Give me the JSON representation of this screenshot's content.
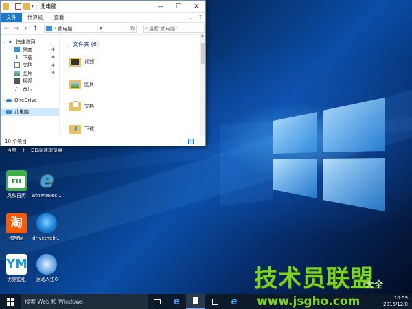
{
  "explorer": {
    "title": "此电脑",
    "window_controls": {
      "minimize": "—",
      "maximize": "☐",
      "close": "✕"
    },
    "ribbon_tabs": [
      "文件",
      "计算机",
      "查看"
    ],
    "address": {
      "back": "←",
      "forward": "→",
      "up": "↑",
      "path": "此电脑",
      "refresh": "↻"
    },
    "search_placeholder": "搜索\"此电脑\"",
    "nav_items": [
      {
        "label": "快速访问",
        "icon": "star-icon"
      },
      {
        "label": "桌面",
        "icon": "desktop-icon",
        "pinned": true
      },
      {
        "label": "下载",
        "icon": "download-icon",
        "pinned": true
      },
      {
        "label": "文档",
        "icon": "document-icon",
        "pinned": true
      },
      {
        "label": "图片",
        "icon": "picture-icon",
        "pinned": true
      },
      {
        "label": "视频",
        "icon": "video-icon"
      },
      {
        "label": "音乐",
        "icon": "music-icon"
      },
      {
        "label": "OneDrive",
        "icon": "cloud-icon"
      },
      {
        "label": "此电脑",
        "icon": "computer-icon",
        "selected": true
      }
    ],
    "section_title": "文件夹 (6)",
    "folders": [
      {
        "label": "视频",
        "icon": "video-folder-icon"
      },
      {
        "label": "图片",
        "icon": "picture-folder-icon"
      },
      {
        "label": "文档",
        "icon": "document-folder-icon"
      },
      {
        "label": "下载",
        "icon": "download-folder-icon"
      }
    ],
    "status": "10 个项目"
  },
  "desktop_icons": [
    {
      "label": "百度一下",
      "icon": "baidu-icon"
    },
    {
      "label": "DD高速浏览器",
      "icon": "dd-browser-icon"
    },
    {
      "label": "风和日历",
      "icon": "calendar-icon"
    },
    {
      "label": "winwireles...",
      "icon": "ie-icon"
    },
    {
      "label": "淘宝网",
      "icon": "taobao-icon"
    },
    {
      "label": "drivethelif...",
      "icon": "driver-icon"
    },
    {
      "label": "优美壁纸",
      "icon": "wallpaper-icon"
    },
    {
      "label": "驱动人生6",
      "icon": "driver-life-icon"
    }
  ],
  "watermark": {
    "line1": "技术员联盟",
    "line2": "www.jsgho.com",
    "line3": "大全"
  },
  "taskbar": {
    "search_placeholder": "搜索 Web 和 Windows",
    "clock_time": "10:59",
    "clock_date": "2016/12/8"
  },
  "colors": {
    "accent": "#1979ca",
    "taskbar": "#0d1a2c",
    "watermark": "#7dd321"
  }
}
